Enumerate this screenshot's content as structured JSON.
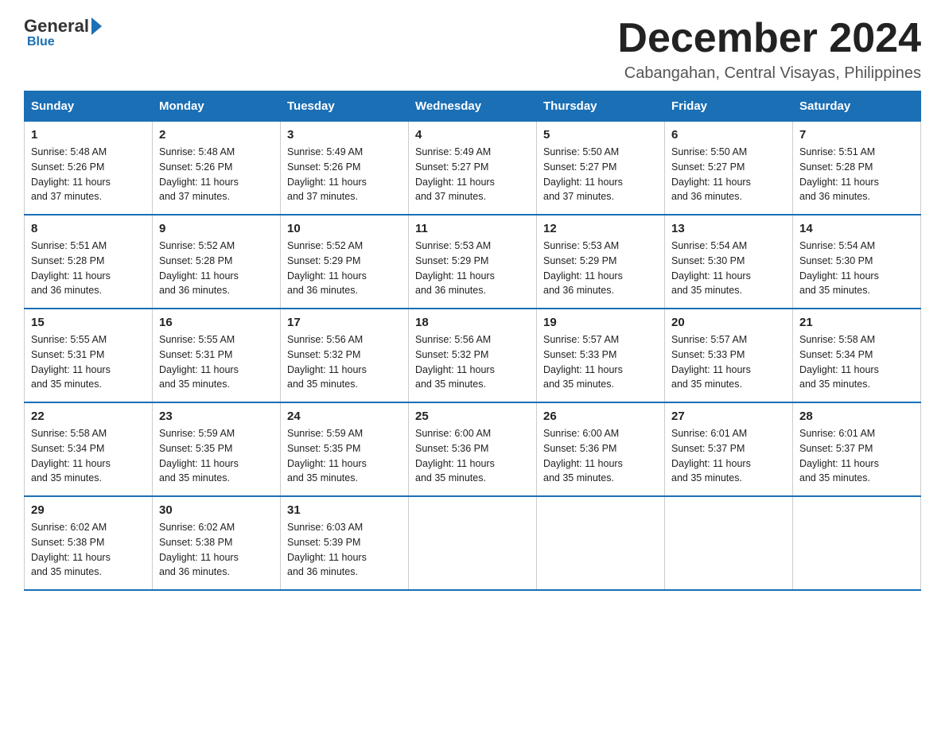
{
  "logo": {
    "general": "General",
    "blue": "Blue",
    "underline": "Blue"
  },
  "title": "December 2024",
  "subtitle": "Cabangahan, Central Visayas, Philippines",
  "days_of_week": [
    "Sunday",
    "Monday",
    "Tuesday",
    "Wednesday",
    "Thursday",
    "Friday",
    "Saturday"
  ],
  "weeks": [
    [
      {
        "day": "1",
        "sunrise": "5:48 AM",
        "sunset": "5:26 PM",
        "daylight": "11 hours and 37 minutes."
      },
      {
        "day": "2",
        "sunrise": "5:48 AM",
        "sunset": "5:26 PM",
        "daylight": "11 hours and 37 minutes."
      },
      {
        "day": "3",
        "sunrise": "5:49 AM",
        "sunset": "5:26 PM",
        "daylight": "11 hours and 37 minutes."
      },
      {
        "day": "4",
        "sunrise": "5:49 AM",
        "sunset": "5:27 PM",
        "daylight": "11 hours and 37 minutes."
      },
      {
        "day": "5",
        "sunrise": "5:50 AM",
        "sunset": "5:27 PM",
        "daylight": "11 hours and 37 minutes."
      },
      {
        "day": "6",
        "sunrise": "5:50 AM",
        "sunset": "5:27 PM",
        "daylight": "11 hours and 36 minutes."
      },
      {
        "day": "7",
        "sunrise": "5:51 AM",
        "sunset": "5:28 PM",
        "daylight": "11 hours and 36 minutes."
      }
    ],
    [
      {
        "day": "8",
        "sunrise": "5:51 AM",
        "sunset": "5:28 PM",
        "daylight": "11 hours and 36 minutes."
      },
      {
        "day": "9",
        "sunrise": "5:52 AM",
        "sunset": "5:28 PM",
        "daylight": "11 hours and 36 minutes."
      },
      {
        "day": "10",
        "sunrise": "5:52 AM",
        "sunset": "5:29 PM",
        "daylight": "11 hours and 36 minutes."
      },
      {
        "day": "11",
        "sunrise": "5:53 AM",
        "sunset": "5:29 PM",
        "daylight": "11 hours and 36 minutes."
      },
      {
        "day": "12",
        "sunrise": "5:53 AM",
        "sunset": "5:29 PM",
        "daylight": "11 hours and 36 minutes."
      },
      {
        "day": "13",
        "sunrise": "5:54 AM",
        "sunset": "5:30 PM",
        "daylight": "11 hours and 35 minutes."
      },
      {
        "day": "14",
        "sunrise": "5:54 AM",
        "sunset": "5:30 PM",
        "daylight": "11 hours and 35 minutes."
      }
    ],
    [
      {
        "day": "15",
        "sunrise": "5:55 AM",
        "sunset": "5:31 PM",
        "daylight": "11 hours and 35 minutes."
      },
      {
        "day": "16",
        "sunrise": "5:55 AM",
        "sunset": "5:31 PM",
        "daylight": "11 hours and 35 minutes."
      },
      {
        "day": "17",
        "sunrise": "5:56 AM",
        "sunset": "5:32 PM",
        "daylight": "11 hours and 35 minutes."
      },
      {
        "day": "18",
        "sunrise": "5:56 AM",
        "sunset": "5:32 PM",
        "daylight": "11 hours and 35 minutes."
      },
      {
        "day": "19",
        "sunrise": "5:57 AM",
        "sunset": "5:33 PM",
        "daylight": "11 hours and 35 minutes."
      },
      {
        "day": "20",
        "sunrise": "5:57 AM",
        "sunset": "5:33 PM",
        "daylight": "11 hours and 35 minutes."
      },
      {
        "day": "21",
        "sunrise": "5:58 AM",
        "sunset": "5:34 PM",
        "daylight": "11 hours and 35 minutes."
      }
    ],
    [
      {
        "day": "22",
        "sunrise": "5:58 AM",
        "sunset": "5:34 PM",
        "daylight": "11 hours and 35 minutes."
      },
      {
        "day": "23",
        "sunrise": "5:59 AM",
        "sunset": "5:35 PM",
        "daylight": "11 hours and 35 minutes."
      },
      {
        "day": "24",
        "sunrise": "5:59 AM",
        "sunset": "5:35 PM",
        "daylight": "11 hours and 35 minutes."
      },
      {
        "day": "25",
        "sunrise": "6:00 AM",
        "sunset": "5:36 PM",
        "daylight": "11 hours and 35 minutes."
      },
      {
        "day": "26",
        "sunrise": "6:00 AM",
        "sunset": "5:36 PM",
        "daylight": "11 hours and 35 minutes."
      },
      {
        "day": "27",
        "sunrise": "6:01 AM",
        "sunset": "5:37 PM",
        "daylight": "11 hours and 35 minutes."
      },
      {
        "day": "28",
        "sunrise": "6:01 AM",
        "sunset": "5:37 PM",
        "daylight": "11 hours and 35 minutes."
      }
    ],
    [
      {
        "day": "29",
        "sunrise": "6:02 AM",
        "sunset": "5:38 PM",
        "daylight": "11 hours and 35 minutes."
      },
      {
        "day": "30",
        "sunrise": "6:02 AM",
        "sunset": "5:38 PM",
        "daylight": "11 hours and 36 minutes."
      },
      {
        "day": "31",
        "sunrise": "6:03 AM",
        "sunset": "5:39 PM",
        "daylight": "11 hours and 36 minutes."
      },
      null,
      null,
      null,
      null
    ]
  ],
  "labels": {
    "sunrise": "Sunrise:",
    "sunset": "Sunset:",
    "daylight": "Daylight:"
  }
}
